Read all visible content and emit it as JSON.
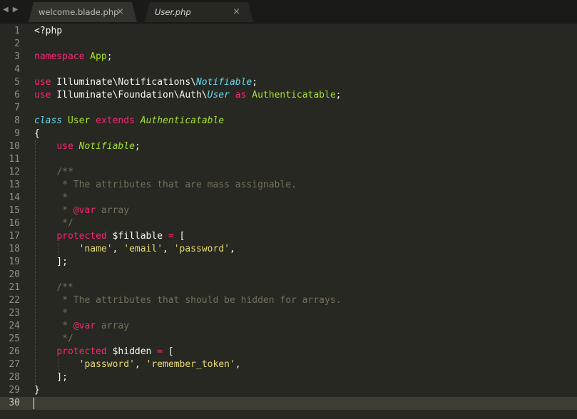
{
  "tabs": [
    {
      "label": "welcome.blade.php",
      "active": false
    },
    {
      "label": "User.php",
      "active": true
    }
  ],
  "nav": {
    "back": "◀",
    "forward": "▶"
  },
  "close_glyph": "×",
  "lines": [
    [
      [
        "<?php",
        ""
      ]
    ],
    [],
    [
      [
        "namespace",
        "kw"
      ],
      [
        " ",
        ""
      ],
      [
        "App",
        "cls"
      ],
      [
        ";",
        ""
      ]
    ],
    [],
    [
      [
        "use",
        "kw"
      ],
      [
        " Illuminate\\Notifications\\",
        ""
      ],
      [
        "Notifiable",
        "sto"
      ],
      [
        ";",
        ""
      ]
    ],
    [
      [
        "use",
        "kw"
      ],
      [
        " Illuminate\\Foundation\\Auth\\",
        ""
      ],
      [
        "User",
        "sto"
      ],
      [
        " ",
        ""
      ],
      [
        "as",
        "kw"
      ],
      [
        " ",
        ""
      ],
      [
        "Authenticatable",
        "cls"
      ],
      [
        ";",
        ""
      ]
    ],
    [],
    [
      [
        "class",
        "sto"
      ],
      [
        " ",
        ""
      ],
      [
        "User",
        "cls"
      ],
      [
        " ",
        ""
      ],
      [
        "extends",
        "kw"
      ],
      [
        " ",
        ""
      ],
      [
        "Authenticatable",
        "inh"
      ]
    ],
    [
      [
        "{",
        ""
      ]
    ],
    [
      [
        "    ",
        ""
      ],
      [
        "use",
        "kw"
      ],
      [
        " ",
        ""
      ],
      [
        "Notifiable",
        "inh"
      ],
      [
        ";",
        ""
      ]
    ],
    [],
    [
      [
        "    ",
        ""
      ],
      [
        "/**",
        "cmt"
      ]
    ],
    [
      [
        "     ",
        ""
      ],
      [
        "* The attributes that are mass assignable.",
        "cmt"
      ]
    ],
    [
      [
        "     ",
        ""
      ],
      [
        "*",
        "cmt"
      ]
    ],
    [
      [
        "     ",
        ""
      ],
      [
        "* ",
        "cmt"
      ],
      [
        "@var",
        "dvar"
      ],
      [
        " array",
        "cmt"
      ]
    ],
    [
      [
        "     ",
        ""
      ],
      [
        "*/",
        "cmt"
      ]
    ],
    [
      [
        "    ",
        ""
      ],
      [
        "protected",
        "kw"
      ],
      [
        " $fillable ",
        ""
      ],
      [
        "=",
        "kw"
      ],
      [
        " [",
        ""
      ]
    ],
    [
      [
        "        ",
        ""
      ],
      [
        "'name'",
        "str"
      ],
      [
        ", ",
        ""
      ],
      [
        "'email'",
        "str"
      ],
      [
        ", ",
        ""
      ],
      [
        "'password'",
        "str"
      ],
      [
        ",",
        ""
      ]
    ],
    [
      [
        "    ];",
        ""
      ]
    ],
    [],
    [
      [
        "    ",
        ""
      ],
      [
        "/**",
        "cmt"
      ]
    ],
    [
      [
        "     ",
        ""
      ],
      [
        "* The attributes that should be hidden for arrays.",
        "cmt"
      ]
    ],
    [
      [
        "     ",
        ""
      ],
      [
        "*",
        "cmt"
      ]
    ],
    [
      [
        "     ",
        ""
      ],
      [
        "* ",
        "cmt"
      ],
      [
        "@var",
        "dvar"
      ],
      [
        " array",
        "cmt"
      ]
    ],
    [
      [
        "     ",
        ""
      ],
      [
        "*/",
        "cmt"
      ]
    ],
    [
      [
        "    ",
        ""
      ],
      [
        "protected",
        "kw"
      ],
      [
        " $hidden ",
        ""
      ],
      [
        "=",
        "kw"
      ],
      [
        " [",
        ""
      ]
    ],
    [
      [
        "        ",
        ""
      ],
      [
        "'password'",
        "str"
      ],
      [
        ", ",
        ""
      ],
      [
        "'remember_token'",
        "str"
      ],
      [
        ",",
        ""
      ]
    ],
    [
      [
        "    ];",
        ""
      ]
    ],
    [
      [
        "}",
        ""
      ]
    ],
    []
  ],
  "current_line": 30
}
